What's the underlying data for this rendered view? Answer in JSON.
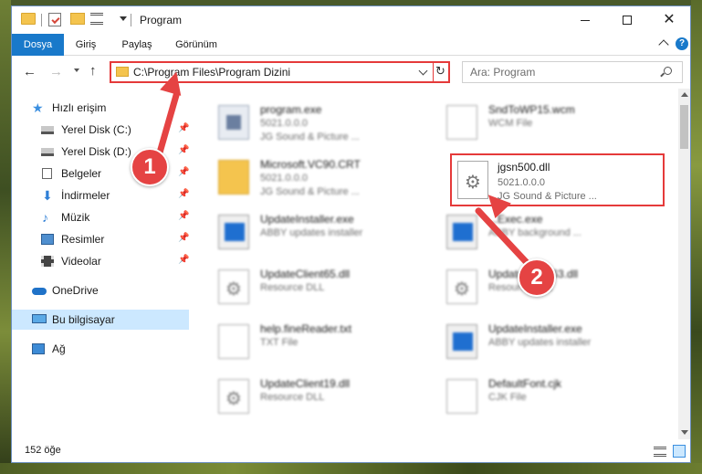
{
  "window": {
    "title": "Program",
    "controls": {
      "minimize": "—",
      "maximize": "□",
      "close": "✕"
    }
  },
  "ribbon": {
    "tabs": [
      "Dosya",
      "Giriş",
      "Paylaş",
      "Görünüm"
    ],
    "help": "?"
  },
  "nav": {
    "address": "C:\\Program Files\\Program Dizini",
    "search_placeholder": "Ara: Program"
  },
  "sidebar": {
    "items": [
      {
        "label": "Hızlı erişim",
        "icon": "star-icon",
        "pinned": false
      },
      {
        "label": "Yerel Disk (C:)",
        "icon": "drive-icon",
        "pinned": true
      },
      {
        "label": "Yerel Disk (D:)",
        "icon": "drive-icon",
        "pinned": true
      },
      {
        "label": "Belgeler",
        "icon": "document-icon",
        "pinned": true
      },
      {
        "label": "İndirmeler",
        "icon": "download-icon",
        "pinned": true
      },
      {
        "label": "Müzik",
        "icon": "music-icon",
        "pinned": true
      },
      {
        "label": "Resimler",
        "icon": "pictures-icon",
        "pinned": true
      },
      {
        "label": "Videolar",
        "icon": "video-icon",
        "pinned": true
      },
      {
        "label": "OneDrive",
        "icon": "cloud-icon",
        "pinned": false
      },
      {
        "label": "Bu bilgisayar",
        "icon": "computer-icon",
        "pinned": false,
        "selected": true
      },
      {
        "label": "Ağ",
        "icon": "network-icon",
        "pinned": false
      }
    ]
  },
  "files": [
    {
      "name": "program.exe",
      "version": "5021.0.0.0",
      "desc": "JG Sound & Picture ...",
      "icon": "app-icon"
    },
    {
      "name": "SndToWP15.wcm",
      "version": "WCM File",
      "desc": "",
      "icon": "file-icon"
    },
    {
      "name": "Microsoft.VC90.CRT",
      "version": "5021.0.0.0",
      "desc": "JG Sound & Picture ...",
      "icon": "folder-icon"
    },
    {
      "name": "jgsn500.dll",
      "version": "5021.0.0.0",
      "desc": "JG Sound & Picture ...",
      "icon": "gear-file-icon",
      "highlighted": true
    },
    {
      "name": "UpdateInstaller.exe",
      "version": "ABBY updates installer",
      "desc": "",
      "icon": "installer-icon"
    },
    {
      "name": "...Exec.exe",
      "version": "ABBY background ...",
      "desc": "",
      "icon": "installer-icon"
    },
    {
      "name": "UpdateClient65.dll",
      "version": "Resource DLL",
      "desc": "",
      "icon": "gear-file-icon"
    },
    {
      "name": "UpdateClient63.dll",
      "version": "Resource DLL",
      "desc": "",
      "icon": "gear-file-icon"
    },
    {
      "name": "help.fineReader.txt",
      "version": "TXT File",
      "desc": "",
      "icon": "file-icon"
    },
    {
      "name": "UpdateInstaller.exe",
      "version": "ABBY updates installer",
      "desc": "",
      "icon": "installer-icon"
    },
    {
      "name": "UpdateClient19.dll",
      "version": "Resource DLL",
      "desc": "",
      "icon": "gear-file-icon"
    },
    {
      "name": "DefaultFont.cjk",
      "version": "CJK File",
      "desc": "",
      "icon": "file-icon"
    }
  ],
  "status": {
    "count": "152 öğe"
  },
  "annotations": {
    "marker1": "1",
    "marker2": "2"
  },
  "colors": {
    "accent": "#1979ca",
    "highlight": "#e53a3a",
    "selection": "#cce8ff"
  }
}
